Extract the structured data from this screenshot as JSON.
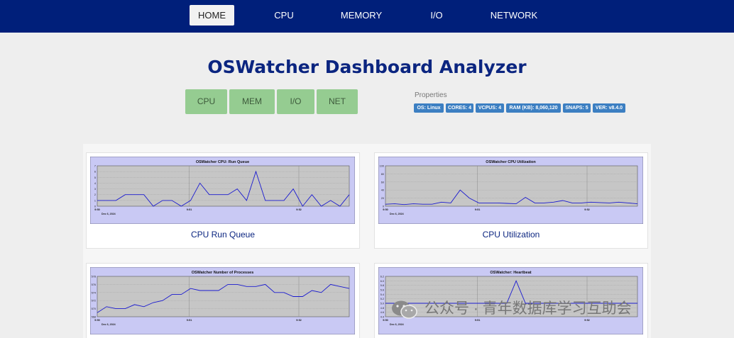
{
  "nav": {
    "items": [
      {
        "label": "HOME",
        "active": true
      },
      {
        "label": "CPU",
        "active": false
      },
      {
        "label": "MEMORY",
        "active": false
      },
      {
        "label": "I/O",
        "active": false
      },
      {
        "label": "NETWORK",
        "active": false
      }
    ]
  },
  "title": "OSWatcher Dashboard Analyzer",
  "quick_buttons": [
    "CPU",
    "MEM",
    "I/O",
    "NET"
  ],
  "properties": {
    "label": "Properties",
    "badges": [
      "OS: Linux",
      "CORES: 4",
      "VCPUS: 4",
      "RAM (KB): 8,060,120",
      "SNAPS: 5",
      "VER: v8.4.0"
    ]
  },
  "colors": {
    "nav_bg": "#001f7a",
    "title": "#0b2580",
    "quick_button_bg": "#95cc91",
    "badge_bg": "#3c7fc2",
    "plot_frame": "#c9c9f4",
    "plot_area": "#c6c6c6",
    "series": "#1a1ad0"
  },
  "charts": [
    {
      "caption": "CPU Run Queue",
      "chart_data": {
        "type": "line",
        "title": "OSWatcher CPU: Run Queue",
        "ylim": [
          0,
          7
        ],
        "y_ticks": [
          "7",
          "6",
          "5",
          "4",
          "3",
          "2",
          "1",
          "0"
        ],
        "x_ticks": [
          "9:50",
          "9:51",
          "9:52"
        ],
        "date_label": "Dec 6, 2024",
        "series": [
          {
            "values": [
              1,
              1,
              1,
              2,
              2,
              2,
              0,
              1,
              1,
              0,
              1,
              4,
              2,
              2,
              2,
              3,
              1,
              6,
              1,
              1,
              1,
              3,
              0,
              2,
              0,
              1,
              0,
              2
            ]
          }
        ]
      }
    },
    {
      "caption": "CPU Utilization",
      "chart_data": {
        "type": "line",
        "title": "OSWatcher CPU Utilization",
        "ylim": [
          0,
          100
        ],
        "y_ticks": [
          "100",
          "80",
          "60",
          "40",
          "20",
          "0"
        ],
        "x_ticks": [
          "9:50",
          "9:51",
          "9:52"
        ],
        "date_label": "Dec 6, 2024",
        "series": [
          {
            "values": [
              5,
              6,
              4,
              6,
              5,
              5,
              10,
              8,
              40,
              20,
              8,
              8,
              8,
              7,
              6,
              22,
              8,
              8,
              10,
              14,
              8,
              8,
              10,
              9,
              8,
              10,
              8,
              6
            ]
          }
        ]
      }
    },
    {
      "caption": "",
      "chart_data": {
        "type": "line",
        "title": "OSWatcher Number of Processes",
        "ylim": [
          568,
          578
        ],
        "y_ticks": [
          "578",
          "576",
          "574",
          "572",
          "570",
          "568"
        ],
        "x_ticks": [
          "9:50",
          "9:51",
          "9:52"
        ],
        "date_label": "Dec 6, 2024",
        "series": [
          {
            "values": [
              569,
              570.5,
              570,
              570,
              571,
              570.5,
              571.5,
              572,
              573.5,
              573.5,
              575,
              574.5,
              574.5,
              574.5,
              576,
              576,
              575.5,
              575.5,
              576,
              574,
              574,
              573,
              573,
              574.5,
              574,
              576,
              575.5,
              575
            ]
          }
        ]
      }
    },
    {
      "caption": "",
      "chart_data": {
        "type": "line",
        "title": "OSWatcher: Heartbeat",
        "ylim": [
          4.4,
          6.2
        ],
        "y_ticks": [
          "6.2",
          "6.0",
          "5.8",
          "5.6",
          "5.4",
          "5.2",
          "5.0",
          "4.8",
          "4.6",
          "4.4"
        ],
        "x_ticks": [
          "9:50",
          "9:51",
          "9:52"
        ],
        "date_label": "Dec 6, 2024",
        "series": [
          {
            "values": [
              5,
              5,
              5,
              5,
              5,
              5,
              5,
              5,
              5,
              5,
              5,
              5,
              5,
              5,
              6,
              5,
              5,
              5,
              5,
              5,
              5,
              5,
              5,
              5,
              5,
              5,
              5,
              5
            ]
          }
        ]
      }
    }
  ],
  "watermark": {
    "text": "公众号 · 青年数据库学习互助会",
    "icon": "wechat-icon"
  }
}
